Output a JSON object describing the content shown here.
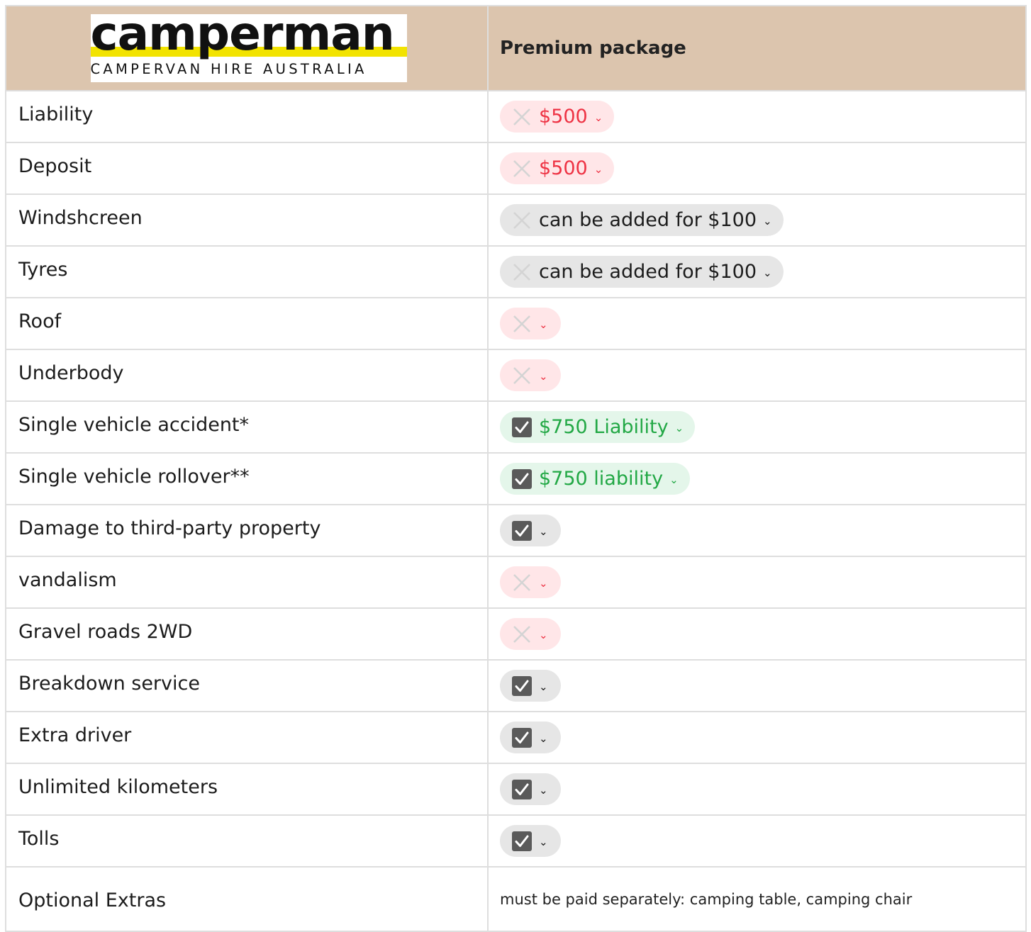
{
  "header": {
    "logo_wordmark": "camperman",
    "logo_tagline": "CAMPERVAN HIRE AUSTRALIA",
    "package_title": "Premium package"
  },
  "rows": [
    {
      "label": "Liability",
      "status": "cross",
      "style": "red",
      "value": "$500"
    },
    {
      "label": "Deposit",
      "status": "cross",
      "style": "red",
      "value": "$500"
    },
    {
      "label": "Windshcreen",
      "status": "cross",
      "style": "grey",
      "value": "can be added for $100"
    },
    {
      "label": "Tyres",
      "status": "cross",
      "style": "grey",
      "value": "can be added for $100"
    },
    {
      "label": "Roof",
      "status": "cross",
      "style": "red",
      "value": ""
    },
    {
      "label": "Underbody",
      "status": "cross",
      "style": "red",
      "value": ""
    },
    {
      "label": "Single vehicle accident*",
      "status": "check",
      "style": "green",
      "value": "$750 Liability"
    },
    {
      "label": "Single vehicle rollover**",
      "status": "check",
      "style": "green",
      "value": "$750 liability"
    },
    {
      "label": "Damage to third-party property",
      "status": "check",
      "style": "grey",
      "value": ""
    },
    {
      "label": "vandalism",
      "status": "cross",
      "style": "red",
      "value": ""
    },
    {
      "label": "Gravel roads 2WD",
      "status": "cross",
      "style": "red",
      "value": ""
    },
    {
      "label": "Breakdown service",
      "status": "check",
      "style": "grey",
      "value": ""
    },
    {
      "label": "Extra driver",
      "status": "check",
      "style": "grey",
      "value": ""
    },
    {
      "label": "Unlimited kilometers",
      "status": "check",
      "style": "grey",
      "value": ""
    },
    {
      "label": "Tolls",
      "status": "check",
      "style": "grey",
      "value": ""
    }
  ],
  "footer": {
    "label": "Optional Extras",
    "value": "must be paid separately: camping table, camping chair"
  },
  "colors": {
    "header_bg": "#dcc5ae",
    "red_pill_bg": "#ffe6e8",
    "red_text": "#ee3344",
    "green_pill_bg": "#e4f6ea",
    "green_text": "#22a845",
    "grey_pill_bg": "#e6e6e6",
    "check_box": "#5a5a5a",
    "logo_yellow": "#f2e300"
  },
  "icons": {
    "cross": "x-icon",
    "check": "checkbox-checked-icon",
    "chevron": "chevron-down-icon"
  }
}
